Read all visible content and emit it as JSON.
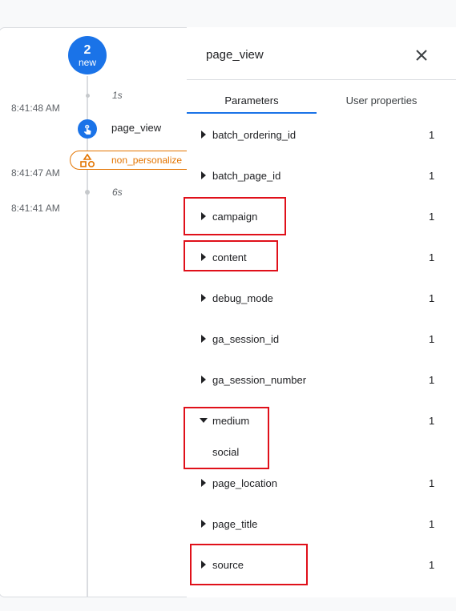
{
  "timeline": {
    "count": "2",
    "count_sub": "new",
    "deltas": [
      "1s",
      "6s"
    ],
    "times": [
      "8:41:48 AM",
      "8:41:47 AM",
      "8:41:41 AM"
    ],
    "event_name": "page_view",
    "event_icon": "touch-icon",
    "conversion_name": "non_personalize",
    "conversion_icon": "shapes-icon"
  },
  "panel": {
    "title": "page_view",
    "close_icon": "close-icon",
    "tabs": [
      "Parameters",
      "User properties"
    ],
    "active_tab": "Parameters",
    "params": [
      {
        "name": "batch_ordering_id",
        "count": "1"
      },
      {
        "name": "batch_page_id",
        "count": "1"
      },
      {
        "name": "campaign",
        "count": "1"
      },
      {
        "name": "content",
        "count": "1"
      },
      {
        "name": "debug_mode",
        "count": "1"
      },
      {
        "name": "ga_session_id",
        "count": "1"
      },
      {
        "name": "ga_session_number",
        "count": "1"
      },
      {
        "name": "medium",
        "count": "1",
        "expanded": true,
        "value": "social"
      },
      {
        "name": "page_location",
        "count": "1"
      },
      {
        "name": "page_title",
        "count": "1"
      },
      {
        "name": "source",
        "count": "1"
      }
    ]
  },
  "colors": {
    "accent": "#1a73e8",
    "warning": "#e37400",
    "highlight": "#e0101a"
  }
}
